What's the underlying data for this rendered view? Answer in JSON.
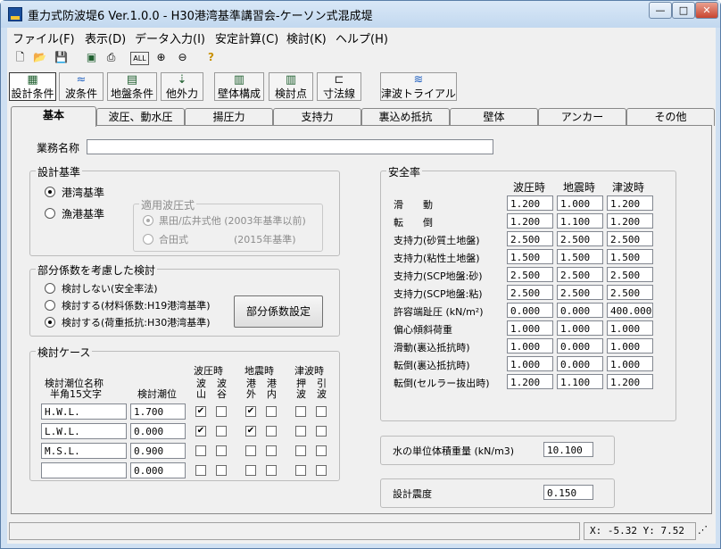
{
  "window": {
    "title": "重力式防波堤6 Ver.1.0.0 - H30港湾基準講習会-ケーソン式混成堤"
  },
  "menu": [
    "ファイル(F)",
    "表示(D)",
    "データ入力(I)",
    "安定計算(C)",
    "検討(K)",
    "ヘルプ(H)"
  ],
  "toolbar2": [
    "設計条件",
    "波条件",
    "地盤条件",
    "他外力",
    "壁体構成",
    "検討点",
    "寸法線",
    "津波トライアル"
  ],
  "tabs": [
    "基本",
    "波圧、動水圧",
    "揚圧力",
    "支持力",
    "裏込め抵抗",
    "壁体",
    "アンカー",
    "その他"
  ],
  "basic": {
    "project_name_label": "業務名称",
    "project_name_value": ""
  },
  "design_standard": {
    "title": "設計基準",
    "opt1": "港湾基準",
    "opt2": "漁港基準",
    "sub_title": "適用波圧式",
    "sub1": "黒田/広井式他 (2003年基準以前)",
    "sub2": "合田式",
    "sub2b": "(2015年基準)"
  },
  "partial": {
    "title": "部分係数を考慮した検討",
    "opt1": "検討しない(安全率法)",
    "opt2": "検討する(材料係数:H19港湾基準)",
    "opt3": "検討する(荷重抵抗:H30港湾基準)",
    "button": "部分係数設定"
  },
  "cases": {
    "title": "検討ケース",
    "h1": "検討潮位名称",
    "h2": "半角15文字",
    "h3": "検討潮位",
    "g1": "波圧時",
    "g2": "地震時",
    "g3": "津波時",
    "c1a": "波",
    "c1b": "山",
    "c2a": "波",
    "c2b": "谷",
    "c3a": "港",
    "c3b": "外",
    "c4a": "港",
    "c4b": "内",
    "c5a": "押",
    "c5b": "波",
    "c6a": "引",
    "c6b": "波",
    "rows": [
      {
        "name": "H.W.L.",
        "tide": "1.700",
        "chk": [
          "✔",
          "",
          "✔",
          "",
          "",
          ""
        ]
      },
      {
        "name": "L.W.L.",
        "tide": "0.000",
        "chk": [
          "✔",
          "",
          "✔",
          "",
          "",
          ""
        ]
      },
      {
        "name": "M.S.L.",
        "tide": "0.900",
        "chk": [
          "",
          "",
          "",
          "",
          "",
          ""
        ]
      },
      {
        "name": "",
        "tide": "0.000",
        "chk": [
          "",
          "",
          "",
          "",
          "",
          ""
        ]
      }
    ]
  },
  "safety": {
    "title": "安全率",
    "cols": [
      "波圧時",
      "地震時",
      "津波時"
    ],
    "rows": [
      {
        "label": "滑　　動",
        "v": [
          "1.200",
          "1.000",
          "1.200"
        ]
      },
      {
        "label": "転　　倒",
        "v": [
          "1.200",
          "1.100",
          "1.200"
        ]
      },
      {
        "label": "支持力(砂質土地盤)",
        "v": [
          "2.500",
          "2.500",
          "2.500"
        ]
      },
      {
        "label": "支持力(粘性土地盤)",
        "v": [
          "1.500",
          "1.500",
          "1.500"
        ]
      },
      {
        "label": "支持力(SCP地盤:砂)",
        "v": [
          "2.500",
          "2.500",
          "2.500"
        ]
      },
      {
        "label": "支持力(SCP地盤:粘)",
        "v": [
          "2.500",
          "2.500",
          "2.500"
        ]
      },
      {
        "label": "許容端趾圧 (kN/m²)",
        "v": [
          "0.000",
          "0.000",
          "400.000"
        ]
      },
      {
        "label": "偏心傾斜荷重",
        "v": [
          "1.000",
          "1.000",
          "1.000"
        ]
      },
      {
        "label": "滑動(裏込抵抗時)",
        "v": [
          "1.000",
          "0.000",
          "1.000"
        ]
      },
      {
        "label": "転倒(裏込抵抗時)",
        "v": [
          "1.000",
          "0.000",
          "1.000"
        ]
      },
      {
        "label": "転倒(セルラー抜出時)",
        "v": [
          "1.200",
          "1.100",
          "1.200"
        ]
      }
    ]
  },
  "water": {
    "label": "水の単位体積重量 (kN/m3)",
    "value": "10.100"
  },
  "seismic": {
    "label": "設計震度",
    "value": "0.150"
  },
  "status": {
    "coords": "X:  -5.32 Y:   7.52"
  }
}
